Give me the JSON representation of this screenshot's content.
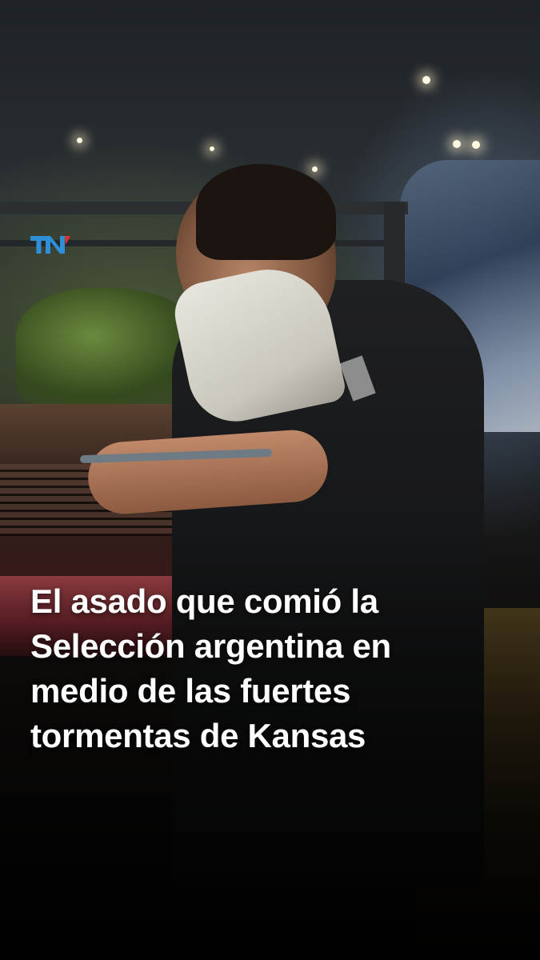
{
  "brand": {
    "logo_text": "TN",
    "logo_colors": {
      "primary": "#2f8fd6",
      "accent": "#e0312f"
    }
  },
  "post": {
    "headline_lines": [
      "El asado que comió la",
      "Selección argentina en",
      "medio de las fuertes",
      "tormentas de Kansas"
    ]
  }
}
